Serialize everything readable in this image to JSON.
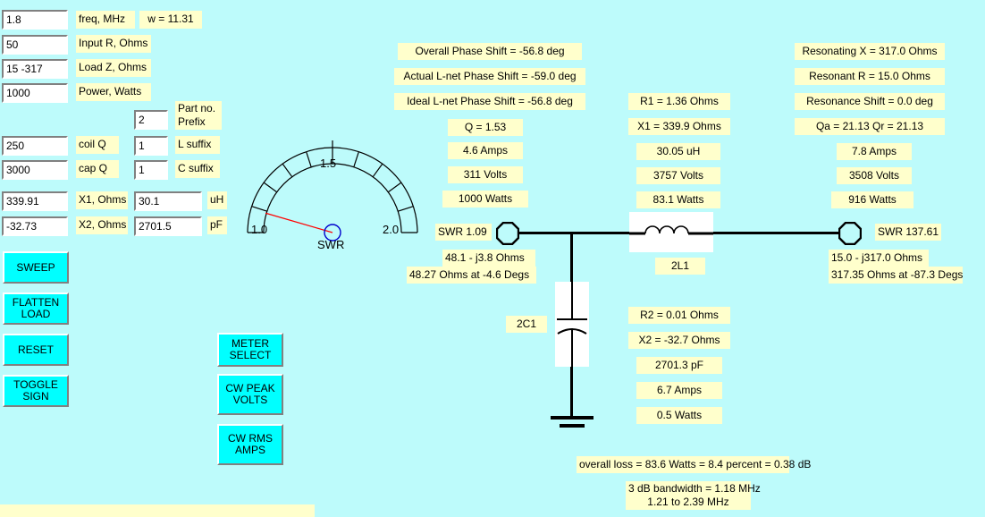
{
  "inputs": {
    "freq": {
      "value": "1.8",
      "label": "freq, MHz"
    },
    "omega": {
      "label": "w = 11.31"
    },
    "input_r": {
      "value": "50",
      "label": "Input R, Ohms"
    },
    "load_z": {
      "value": "15 -317",
      "label": "Load Z, Ohms"
    },
    "power": {
      "value": "1000",
      "label": "Power, Watts"
    },
    "part_prefix": {
      "value": "2",
      "label": "Part no.\nPrefix"
    },
    "coil_q": {
      "value": "250",
      "label": "coil Q"
    },
    "cap_q": {
      "value": "3000",
      "label": "cap Q"
    },
    "l_suffix": {
      "value": "1",
      "label": "L suffix"
    },
    "c_suffix": {
      "value": "1",
      "label": "C suffix"
    },
    "x1": {
      "value": "339.91",
      "label": "X1, Ohms"
    },
    "x1_uh": {
      "value": "30.1",
      "label": "uH"
    },
    "x2": {
      "value": "-32.73",
      "label": "X2, Ohms"
    },
    "x2_pf": {
      "value": "2701.5",
      "label": "pF"
    }
  },
  "buttons": {
    "sweep": "SWEEP",
    "flatten_load": "FLATTEN\nLOAD",
    "reset": "RESET",
    "toggle_sign": "TOGGLE\nSIGN",
    "meter_select": "METER\nSELECT",
    "cw_peak_volts": "CW PEAK\nVOLTS",
    "cw_rms_amps": "CW RMS\nAMPS"
  },
  "meter": {
    "title": "SWR",
    "min_label": "1.0",
    "mid_label": "1.5",
    "max_label": "2.0",
    "min": 1.0,
    "max": 2.0,
    "value": 1.09,
    "segments": 10,
    "needle_color": "#ff0000",
    "hub_color": "#0000cc"
  },
  "phase": {
    "overall": "Overall Phase Shift = -56.8 deg",
    "actual": "Actual L-net Phase Shift = -59.0 deg",
    "ideal": "Ideal L-net Phase Shift = -56.8 deg",
    "q": "Q = 1.53",
    "amps": "4.6 Amps",
    "volts": "311 Volts",
    "watts": "1000 Watts"
  },
  "resonance": {
    "resonating_x": "Resonating X = 317.0 Ohms",
    "resonant_r": "Resonant R = 15.0 Ohms",
    "resonance_shift": "Resonance Shift = 0.0 deg",
    "q_values": "Qa = 21.13            Qr = 21.13",
    "amps": "7.8 Amps",
    "volts": "3508 Volts",
    "watts": "916 Watts"
  },
  "inductor": {
    "r1": "R1 = 1.36 Ohms",
    "x1": "X1 = 339.9 Ohms",
    "uh": "30.05 uH",
    "volts": "3757 Volts",
    "watts": "83.1 Watts",
    "ref": "2L1"
  },
  "capacitor": {
    "ref": "2C1",
    "r2": "R2 = 0.01 Ohms",
    "x2": "X2 = -32.7 Ohms",
    "pf": "2701.3 pF",
    "amps": "6.7 Amps",
    "watts": "0.5 Watts"
  },
  "input_port": {
    "swr": "SWR 1.09",
    "z_rect": "48.1 - j3.8 Ohms",
    "z_polar": "48.27 Ohms at -4.6 Degs"
  },
  "output_port": {
    "swr": "SWR 137.61",
    "z_rect": "15.0 - j317.0 Ohms",
    "z_polar": "317.35 Ohms at -87.3 Degs"
  },
  "footer": {
    "loss": "overall loss = 83.6 Watts = 8.4 percent = 0.38 dB",
    "bandwidth_1": "3 dB bandwidth = 1.18 MHz",
    "bandwidth_2": "1.21 to 2.39 MHz"
  },
  "colors": {
    "background": "#bdfbfb",
    "label_bg": "#ffffcc",
    "button_bg": "#00ffff",
    "wire": "#000000"
  }
}
